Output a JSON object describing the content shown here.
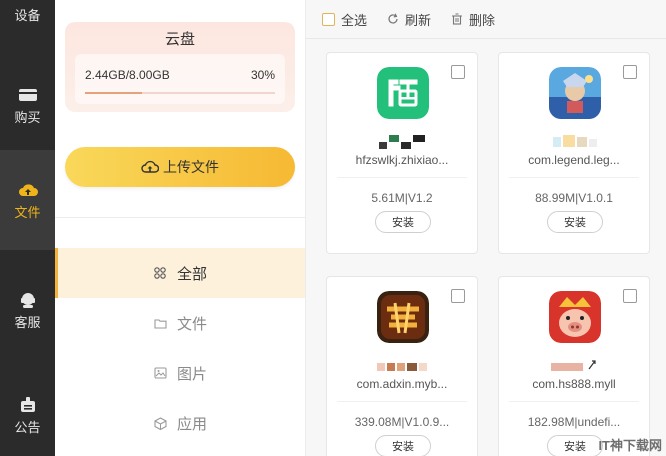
{
  "sidebar": {
    "items": [
      {
        "label": "设备",
        "icon": "device-icon",
        "active": false
      },
      {
        "label": "购买",
        "icon": "wallet-icon",
        "active": false
      },
      {
        "label": "文件",
        "icon": "cloud-upload-icon",
        "active": true
      },
      {
        "label": "客服",
        "icon": "headset-icon",
        "active": false
      },
      {
        "label": "公告",
        "icon": "notice-icon",
        "active": false
      }
    ]
  },
  "cloud": {
    "title": "云盘",
    "used": "2.44GB/8.00GB",
    "percent_label": "30%",
    "percent": 30
  },
  "upload": {
    "label": "上传文件",
    "icon": "cloud-upload-icon"
  },
  "nav": {
    "items": [
      {
        "label": "全部",
        "icon": "grid-icon",
        "active": true
      },
      {
        "label": "文件",
        "icon": "folder-icon",
        "active": false
      },
      {
        "label": "图片",
        "icon": "image-icon",
        "active": false
      },
      {
        "label": "应用",
        "icon": "app-box-icon",
        "active": false
      }
    ]
  },
  "toolbar": {
    "select_all": "全选",
    "refresh": "刷新",
    "delete": "删除"
  },
  "files": [
    {
      "package": "hfzswlkj.zhixiao...",
      "meta": "5.61M|V1.2",
      "install": "安装",
      "icon": "zhi-app-icon"
    },
    {
      "package": "com.legend.leg...",
      "meta": "88.99M|V1.0.1",
      "install": "安装",
      "icon": "legend-game-icon"
    },
    {
      "package": "com.adxin.myb...",
      "meta": "339.08M|V1.0.9...",
      "install": "安装",
      "icon": "mojie-game-icon"
    },
    {
      "package": "com.hs888.myll",
      "meta": "182.98M|undefi...",
      "install": "安装",
      "icon": "pig-game-icon"
    }
  ],
  "colors": {
    "sidebar_bg": "#2b2b2b",
    "accent": "#f0b41a",
    "nav_active_bg": "#fdf1dc"
  },
  "watermark": "IT神下载网"
}
